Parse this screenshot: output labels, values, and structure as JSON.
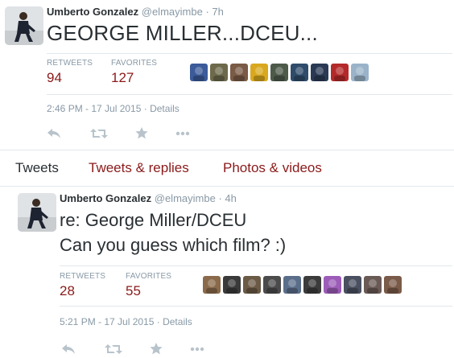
{
  "tweet1": {
    "fullname": "Umberto Gonzalez",
    "handle": "@elmayimbe",
    "dot": "·",
    "age": "7h",
    "text": "GEORGE MILLER...DCEU...",
    "retweets_label": "RETWEETS",
    "retweets": "94",
    "favorites_label": "FAVORITES",
    "favorites": "127",
    "timestamp": "2:46 PM - 17 Jul 2015",
    "details": "Details",
    "sep": "·",
    "favoriter_colors": [
      "#3b5b9a",
      "#6d6a4b",
      "#7a5b45",
      "#d9a81e",
      "#4d5a4a",
      "#2f4c6b",
      "#2a3a55",
      "#b42a2a",
      "#9ab3c9"
    ]
  },
  "tabs": {
    "tweets": "Tweets",
    "replies": "Tweets & replies",
    "media": "Photos & videos",
    "active_color": "#292f33",
    "link_color": "#8b1a1a"
  },
  "tweet2": {
    "fullname": "Umberto Gonzalez",
    "handle": "@elmayimbe",
    "dot": "·",
    "age": "4h",
    "text_line1": "re: George Miller/DCEU",
    "text_line2": "Can you guess which film? :)",
    "retweets_label": "RETWEETS",
    "retweets": "28",
    "favorites_label": "FAVORITES",
    "favorites": "55",
    "timestamp": "5:21 PM - 17 Jul 2015",
    "details": "Details",
    "sep": "·",
    "favoriter_colors": [
      "#8a6a4a",
      "#3a3a3a",
      "#6b5a45",
      "#4b4b4b",
      "#5a6e8a",
      "#3b3b3b",
      "#9c5cb8",
      "#4a5060",
      "#6a5a55",
      "#7a5a48"
    ]
  },
  "icons": [
    "reply-icon",
    "retweet-icon",
    "favorite-icon",
    "more-icon"
  ]
}
